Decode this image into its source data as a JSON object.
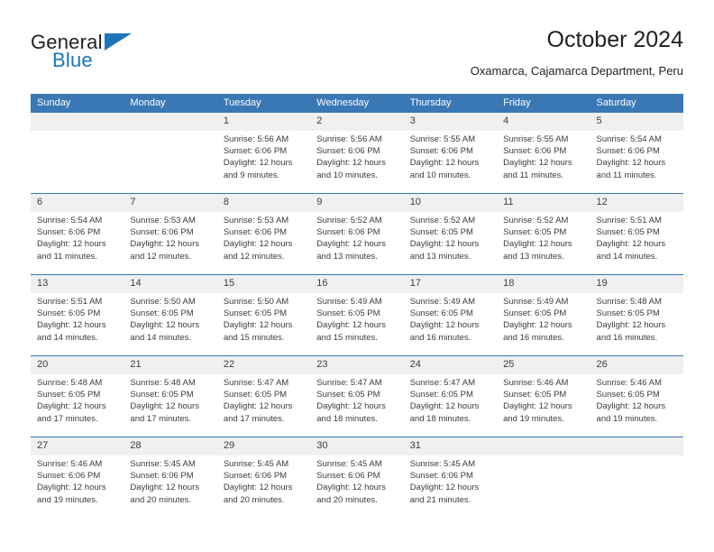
{
  "brand": {
    "name_part1": "General",
    "name_part2": "Blue",
    "accent_color": "#1b75bb"
  },
  "header": {
    "title": "October 2024",
    "subtitle": "Oxamarca, Cajamarca Department, Peru"
  },
  "theme": {
    "header_blue": "#3a77b5",
    "daynum_band": "#f0f0f0",
    "text": "#3c3c3c"
  },
  "weekday_headers": [
    "Sunday",
    "Monday",
    "Tuesday",
    "Wednesday",
    "Thursday",
    "Friday",
    "Saturday"
  ],
  "weeks": [
    [
      {
        "day": "",
        "lines": []
      },
      {
        "day": "",
        "lines": []
      },
      {
        "day": "1",
        "lines": [
          "Sunrise: 5:56 AM",
          "Sunset: 6:06 PM",
          "Daylight: 12 hours",
          "and 9 minutes."
        ]
      },
      {
        "day": "2",
        "lines": [
          "Sunrise: 5:56 AM",
          "Sunset: 6:06 PM",
          "Daylight: 12 hours",
          "and 10 minutes."
        ]
      },
      {
        "day": "3",
        "lines": [
          "Sunrise: 5:55 AM",
          "Sunset: 6:06 PM",
          "Daylight: 12 hours",
          "and 10 minutes."
        ]
      },
      {
        "day": "4",
        "lines": [
          "Sunrise: 5:55 AM",
          "Sunset: 6:06 PM",
          "Daylight: 12 hours",
          "and 11 minutes."
        ]
      },
      {
        "day": "5",
        "lines": [
          "Sunrise: 5:54 AM",
          "Sunset: 6:06 PM",
          "Daylight: 12 hours",
          "and 11 minutes."
        ]
      }
    ],
    [
      {
        "day": "6",
        "lines": [
          "Sunrise: 5:54 AM",
          "Sunset: 6:06 PM",
          "Daylight: 12 hours",
          "and 11 minutes."
        ]
      },
      {
        "day": "7",
        "lines": [
          "Sunrise: 5:53 AM",
          "Sunset: 6:06 PM",
          "Daylight: 12 hours",
          "and 12 minutes."
        ]
      },
      {
        "day": "8",
        "lines": [
          "Sunrise: 5:53 AM",
          "Sunset: 6:06 PM",
          "Daylight: 12 hours",
          "and 12 minutes."
        ]
      },
      {
        "day": "9",
        "lines": [
          "Sunrise: 5:52 AM",
          "Sunset: 6:06 PM",
          "Daylight: 12 hours",
          "and 13 minutes."
        ]
      },
      {
        "day": "10",
        "lines": [
          "Sunrise: 5:52 AM",
          "Sunset: 6:05 PM",
          "Daylight: 12 hours",
          "and 13 minutes."
        ]
      },
      {
        "day": "11",
        "lines": [
          "Sunrise: 5:52 AM",
          "Sunset: 6:05 PM",
          "Daylight: 12 hours",
          "and 13 minutes."
        ]
      },
      {
        "day": "12",
        "lines": [
          "Sunrise: 5:51 AM",
          "Sunset: 6:05 PM",
          "Daylight: 12 hours",
          "and 14 minutes."
        ]
      }
    ],
    [
      {
        "day": "13",
        "lines": [
          "Sunrise: 5:51 AM",
          "Sunset: 6:05 PM",
          "Daylight: 12 hours",
          "and 14 minutes."
        ]
      },
      {
        "day": "14",
        "lines": [
          "Sunrise: 5:50 AM",
          "Sunset: 6:05 PM",
          "Daylight: 12 hours",
          "and 14 minutes."
        ]
      },
      {
        "day": "15",
        "lines": [
          "Sunrise: 5:50 AM",
          "Sunset: 6:05 PM",
          "Daylight: 12 hours",
          "and 15 minutes."
        ]
      },
      {
        "day": "16",
        "lines": [
          "Sunrise: 5:49 AM",
          "Sunset: 6:05 PM",
          "Daylight: 12 hours",
          "and 15 minutes."
        ]
      },
      {
        "day": "17",
        "lines": [
          "Sunrise: 5:49 AM",
          "Sunset: 6:05 PM",
          "Daylight: 12 hours",
          "and 16 minutes."
        ]
      },
      {
        "day": "18",
        "lines": [
          "Sunrise: 5:49 AM",
          "Sunset: 6:05 PM",
          "Daylight: 12 hours",
          "and 16 minutes."
        ]
      },
      {
        "day": "19",
        "lines": [
          "Sunrise: 5:48 AM",
          "Sunset: 6:05 PM",
          "Daylight: 12 hours",
          "and 16 minutes."
        ]
      }
    ],
    [
      {
        "day": "20",
        "lines": [
          "Sunrise: 5:48 AM",
          "Sunset: 6:05 PM",
          "Daylight: 12 hours",
          "and 17 minutes."
        ]
      },
      {
        "day": "21",
        "lines": [
          "Sunrise: 5:48 AM",
          "Sunset: 6:05 PM",
          "Daylight: 12 hours",
          "and 17 minutes."
        ]
      },
      {
        "day": "22",
        "lines": [
          "Sunrise: 5:47 AM",
          "Sunset: 6:05 PM",
          "Daylight: 12 hours",
          "and 17 minutes."
        ]
      },
      {
        "day": "23",
        "lines": [
          "Sunrise: 5:47 AM",
          "Sunset: 6:05 PM",
          "Daylight: 12 hours",
          "and 18 minutes."
        ]
      },
      {
        "day": "24",
        "lines": [
          "Sunrise: 5:47 AM",
          "Sunset: 6:05 PM",
          "Daylight: 12 hours",
          "and 18 minutes."
        ]
      },
      {
        "day": "25",
        "lines": [
          "Sunrise: 5:46 AM",
          "Sunset: 6:05 PM",
          "Daylight: 12 hours",
          "and 19 minutes."
        ]
      },
      {
        "day": "26",
        "lines": [
          "Sunrise: 5:46 AM",
          "Sunset: 6:05 PM",
          "Daylight: 12 hours",
          "and 19 minutes."
        ]
      }
    ],
    [
      {
        "day": "27",
        "lines": [
          "Sunrise: 5:46 AM",
          "Sunset: 6:06 PM",
          "Daylight: 12 hours",
          "and 19 minutes."
        ]
      },
      {
        "day": "28",
        "lines": [
          "Sunrise: 5:45 AM",
          "Sunset: 6:06 PM",
          "Daylight: 12 hours",
          "and 20 minutes."
        ]
      },
      {
        "day": "29",
        "lines": [
          "Sunrise: 5:45 AM",
          "Sunset: 6:06 PM",
          "Daylight: 12 hours",
          "and 20 minutes."
        ]
      },
      {
        "day": "30",
        "lines": [
          "Sunrise: 5:45 AM",
          "Sunset: 6:06 PM",
          "Daylight: 12 hours",
          "and 20 minutes."
        ]
      },
      {
        "day": "31",
        "lines": [
          "Sunrise: 5:45 AM",
          "Sunset: 6:06 PM",
          "Daylight: 12 hours",
          "and 21 minutes."
        ]
      },
      {
        "day": "",
        "lines": []
      },
      {
        "day": "",
        "lines": []
      }
    ]
  ]
}
